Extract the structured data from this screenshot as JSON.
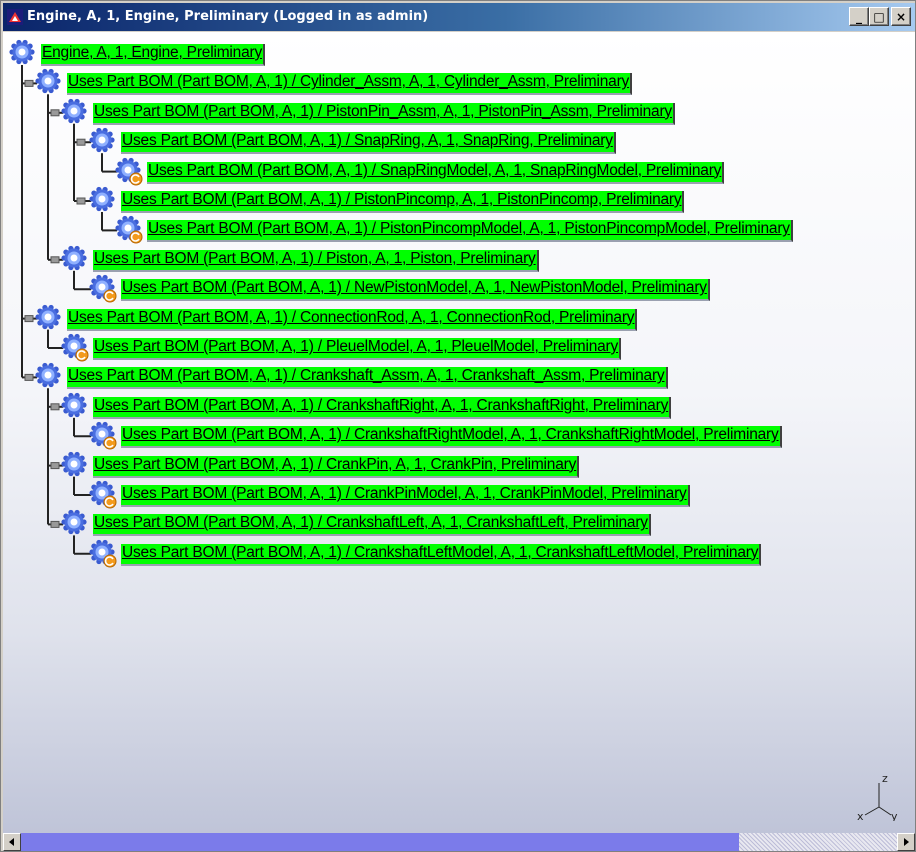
{
  "window": {
    "title": "Engine, A, 1, Engine, Preliminary (Logged in as admin)",
    "buttons": [
      "_",
      "□",
      "×"
    ]
  },
  "tree": [
    {
      "label": "Engine, A, 1, Engine, Preliminary",
      "icon": "gear-icon"
    },
    {
      "label": "Uses Part BOM (Part BOM, A, 1) / Cylinder_Assm, A, 1, Cylinder_Assm, Preliminary",
      "icon": "gear-icon"
    },
    {
      "label": "Uses Part BOM (Part BOM, A, 1) / PistonPin_Assm, A, 1, PistonPin_Assm, Preliminary",
      "icon": "gear-icon"
    },
    {
      "label": "Uses Part BOM (Part BOM, A, 1) / SnapRing, A, 1, SnapRing, Preliminary",
      "icon": "gear-icon"
    },
    {
      "label": "Uses Part BOM (Part BOM, A, 1) / SnapRingModel, A, 1, SnapRingModel, Preliminary",
      "icon": "part-model-icon"
    },
    {
      "label": "Uses Part BOM (Part BOM, A, 1) / PistonPincomp, A, 1, PistonPincomp, Preliminary",
      "icon": "gear-icon"
    },
    {
      "label": "Uses Part BOM (Part BOM, A, 1) / PistonPincompModel, A, 1, PistonPincompModel, Preliminary",
      "icon": "part-model-icon"
    },
    {
      "label": "Uses Part BOM (Part BOM, A, 1) / Piston, A, 1, Piston, Preliminary",
      "icon": "gear-icon"
    },
    {
      "label": "Uses Part BOM (Part BOM, A, 1) / NewPistonModel, A, 1, NewPistonModel, Preliminary",
      "icon": "part-model-icon"
    },
    {
      "label": "Uses Part BOM (Part BOM, A, 1) / ConnectionRod, A, 1, ConnectionRod, Preliminary",
      "icon": "gear-icon"
    },
    {
      "label": "Uses Part BOM (Part BOM, A, 1) / PleuelModel, A, 1, PleuelModel, Preliminary",
      "icon": "part-model-icon"
    },
    {
      "label": "Uses Part BOM (Part BOM, A, 1) / Crankshaft_Assm, A, 1, Crankshaft_Assm, Preliminary",
      "icon": "gear-icon"
    },
    {
      "label": "Uses Part BOM (Part BOM, A, 1) / CrankshaftRight, A, 1, CrankshaftRight, Preliminary",
      "icon": "gear-icon"
    },
    {
      "label": "Uses Part BOM (Part BOM, A, 1) / CrankshaftRightModel, A, 1, CrankshaftRightModel, Preliminary",
      "icon": "part-model-icon"
    },
    {
      "label": "Uses Part BOM (Part BOM, A, 1) / CrankPin, A, 1, CrankPin, Preliminary",
      "icon": "gear-icon"
    },
    {
      "label": "Uses Part BOM (Part BOM, A, 1) / CrankPinModel, A, 1, CrankPinModel, Preliminary",
      "icon": "part-model-icon"
    },
    {
      "label": "Uses Part BOM (Part BOM, A, 1) / CrankshaftLeft, A, 1, CrankshaftLeft, Preliminary",
      "icon": "gear-icon"
    },
    {
      "label": "Uses Part BOM (Part BOM, A, 1) / CrankshaftLeftModel, A, 1, CrankshaftLeftModel, Preliminary",
      "icon": "part-model-icon"
    }
  ],
  "compass": {
    "x": "x",
    "y": "y",
    "z": "z"
  },
  "colors": {
    "label_bg": "#00ff00",
    "title_start": "#0a246a",
    "title_end": "#a6caf0",
    "scroll_thumb": "#7b7bea"
  }
}
